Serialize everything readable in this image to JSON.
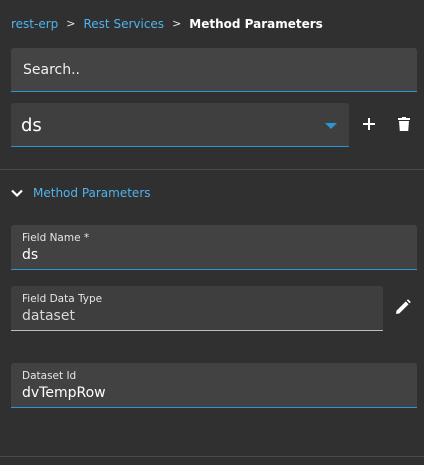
{
  "breadcrumb": {
    "items": [
      "rest-erp",
      "Rest Services"
    ],
    "separator": ">",
    "current": "Method Parameters"
  },
  "search": {
    "placeholder": "Search..",
    "value": ""
  },
  "selector": {
    "value": "ds"
  },
  "icons": {
    "add": "plus-icon",
    "delete": "trash-icon",
    "collapse": "chevron-down-icon",
    "edit": "pencil-icon"
  },
  "section": {
    "title": "Method Parameters",
    "expanded": true
  },
  "fields": {
    "field_name": {
      "label": "Field Name *",
      "value": "ds"
    },
    "field_data_type": {
      "label": "Field Data Type",
      "value": "dataset"
    },
    "dataset_id": {
      "label": "Dataset Id",
      "value": "dvTempRow"
    }
  },
  "colors": {
    "background": "#303030",
    "accent": "#2e95d3",
    "link": "#4fb3ee",
    "field_bg": "#424242"
  }
}
